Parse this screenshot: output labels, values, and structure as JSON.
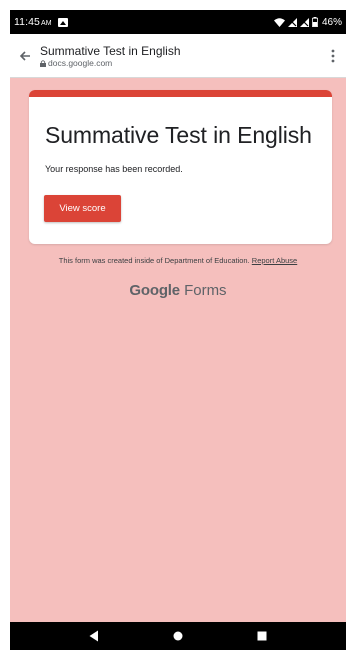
{
  "status_bar": {
    "time": "11:45",
    "ampm": "AM",
    "battery": "46%"
  },
  "browser": {
    "page_title": "Summative Test in English",
    "domain": "docs.google.com"
  },
  "form": {
    "title": "Summative Test in English",
    "message": "Your response has been recorded.",
    "view_score_label": "View score",
    "accent_color": "#db4437",
    "background_color": "#f5bfbd"
  },
  "footer": {
    "created_text": "This form was created inside of Department of Education.",
    "report_abuse_label": "Report Abuse",
    "logo_google": "Google",
    "logo_forms": "Forms"
  }
}
